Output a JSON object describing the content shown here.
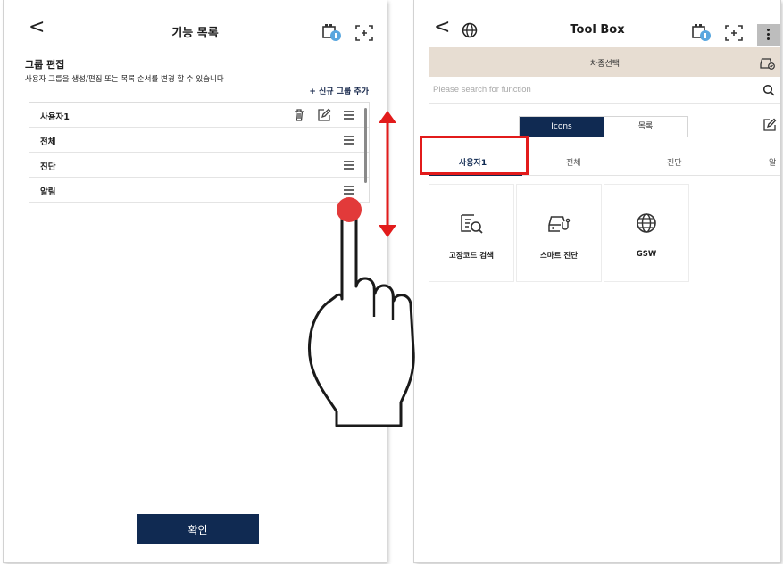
{
  "left_screen": {
    "header": {
      "back_label": "<",
      "title": "기능 목록"
    },
    "section_title": "그룹 편집",
    "section_description": "사용자 그룹을 생성/편집 또는 목록 순서를 변경 할 수 있습니다",
    "add_group_label": "+ 신규 그룹 추가",
    "groups": [
      {
        "label": "사용자1"
      },
      {
        "label": "전체"
      },
      {
        "label": "진단"
      },
      {
        "label": "알림"
      }
    ],
    "confirm_label": "확인"
  },
  "right_screen": {
    "header": {
      "back_label": "<",
      "title": "Tool Box"
    },
    "vehicle_bar_label": "차종선택",
    "search": {
      "placeholder": "Please search for function",
      "value": ""
    },
    "view_toggle": {
      "icons_label": "Icons",
      "list_label": "목록"
    },
    "tabs": [
      {
        "label": "사용자1",
        "active": true
      },
      {
        "label": "전체",
        "active": false
      },
      {
        "label": "진단",
        "active": false
      },
      {
        "label": "알",
        "active": false
      }
    ],
    "tiles": [
      {
        "label": "고장코드 검색",
        "icon": "dtc-search-icon"
      },
      {
        "label": "스마트 진단",
        "icon": "smart-diagnosis-icon"
      },
      {
        "label": "GSW",
        "icon": "globe-icon"
      }
    ]
  },
  "colors": {
    "accent_navy": "#102a52",
    "highlight_red": "#e21b1b",
    "vehicle_bar": "#e7ddd2"
  }
}
